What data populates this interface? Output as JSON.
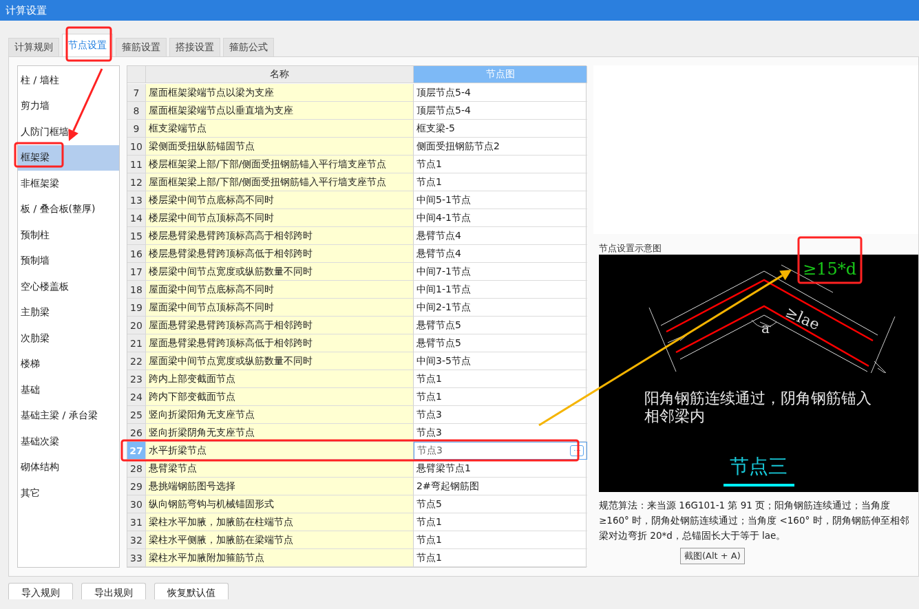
{
  "window": {
    "title": "计算设置"
  },
  "tabs": [
    {
      "label": "计算规则",
      "selected": false
    },
    {
      "label": "节点设置",
      "selected": true
    },
    {
      "label": "箍筋设置",
      "selected": false
    },
    {
      "label": "搭接设置",
      "selected": false
    },
    {
      "label": "箍筋公式",
      "selected": false
    }
  ],
  "sidebar": {
    "items": [
      {
        "label": "柱 / 墙柱",
        "selected": false
      },
      {
        "label": "剪力墙",
        "selected": false
      },
      {
        "label": "人防门框墙",
        "selected": false
      },
      {
        "label": "框架梁",
        "selected": true
      },
      {
        "label": "非框架梁",
        "selected": false
      },
      {
        "label": "板 / 叠合板(整厚)",
        "selected": false
      },
      {
        "label": "预制柱",
        "selected": false
      },
      {
        "label": "预制墙",
        "selected": false
      },
      {
        "label": "空心楼盖板",
        "selected": false
      },
      {
        "label": "主肋梁",
        "selected": false
      },
      {
        "label": "次肋梁",
        "selected": false
      },
      {
        "label": "楼梯",
        "selected": false
      },
      {
        "label": "基础",
        "selected": false
      },
      {
        "label": "基础主梁 / 承台梁",
        "selected": false
      },
      {
        "label": "基础次梁",
        "selected": false
      },
      {
        "label": "砌体结构",
        "selected": false
      },
      {
        "label": "其它",
        "selected": false
      }
    ]
  },
  "table": {
    "columns": [
      "名称",
      "节点图"
    ],
    "cell_button": "⋯",
    "rows": [
      {
        "number": "7",
        "name": "屋面框架梁端节点以梁为支座",
        "value": "顶层节点5-4",
        "selected": false
      },
      {
        "number": "8",
        "name": "屋面框架梁端节点以垂直墙为支座",
        "value": "顶层节点5-4",
        "selected": false
      },
      {
        "number": "9",
        "name": "框支梁端节点",
        "value": "框支梁-5",
        "selected": false
      },
      {
        "number": "10",
        "name": "梁侧面受扭纵筋锚固节点",
        "value": "侧面受扭钢筋节点2",
        "selected": false
      },
      {
        "number": "11",
        "name": "楼层框架梁上部/下部/侧面受扭钢筋锚入平行墙支座节点",
        "value": "节点1",
        "selected": false
      },
      {
        "number": "12",
        "name": "屋面框架梁上部/下部/侧面受扭钢筋锚入平行墙支座节点",
        "value": "节点1",
        "selected": false
      },
      {
        "number": "13",
        "name": "楼层梁中间节点底标高不同时",
        "value": "中间5-1节点",
        "selected": false
      },
      {
        "number": "14",
        "name": "楼层梁中间节点顶标高不同时",
        "value": "中间4-1节点",
        "selected": false
      },
      {
        "number": "15",
        "name": "楼层悬臂梁悬臂跨顶标高高于相邻跨时",
        "value": "悬臂节点4",
        "selected": false
      },
      {
        "number": "16",
        "name": "楼层悬臂梁悬臂跨顶标高低于相邻跨时",
        "value": "悬臂节点4",
        "selected": false
      },
      {
        "number": "17",
        "name": "楼层梁中间节点宽度或纵筋数量不同时",
        "value": "中间7-1节点",
        "selected": false
      },
      {
        "number": "18",
        "name": "屋面梁中间节点底标高不同时",
        "value": "中间1-1节点",
        "selected": false
      },
      {
        "number": "19",
        "name": "屋面梁中间节点顶标高不同时",
        "value": "中间2-1节点",
        "selected": false
      },
      {
        "number": "20",
        "name": "屋面悬臂梁悬臂跨顶标高高于相邻跨时",
        "value": "悬臂节点5",
        "selected": false
      },
      {
        "number": "21",
        "name": "屋面悬臂梁悬臂跨顶标高低于相邻跨时",
        "value": "悬臂节点5",
        "selected": false
      },
      {
        "number": "22",
        "name": "屋面梁中间节点宽度或纵筋数量不同时",
        "value": "中间3-5节点",
        "selected": false
      },
      {
        "number": "23",
        "name": "跨内上部变截面节点",
        "value": "节点1",
        "selected": false
      },
      {
        "number": "24",
        "name": "跨内下部变截面节点",
        "value": "节点1",
        "selected": false
      },
      {
        "number": "25",
        "name": "竖向折梁阳角无支座节点",
        "value": "节点3",
        "selected": false
      },
      {
        "number": "26",
        "name": "竖向折梁阴角无支座节点",
        "value": "节点3",
        "selected": false
      },
      {
        "number": "27",
        "name": "水平折梁节点",
        "value": "节点3",
        "selected": true
      },
      {
        "number": "28",
        "name": "悬臂梁节点",
        "value": "悬臂梁节点1",
        "selected": false
      },
      {
        "number": "29",
        "name": "悬挑端钢筋图号选择",
        "value": "2#弯起钢筋图",
        "selected": false
      },
      {
        "number": "30",
        "name": "纵向钢筋弯钩与机械锚固形式",
        "value": "节点5",
        "selected": false
      },
      {
        "number": "31",
        "name": "梁柱水平加腋，加腋筋在柱端节点",
        "value": "节点1",
        "selected": false
      },
      {
        "number": "32",
        "name": "梁柱水平侧腋，加腋筋在梁端节点",
        "value": "节点1",
        "selected": false
      },
      {
        "number": "33",
        "name": "梁柱水平加腋附加箍筋节点",
        "value": "节点1",
        "selected": false
      }
    ]
  },
  "diagram_panel": {
    "title": "节点设置示意图",
    "diagram": {
      "top_dimension": "≥15*d",
      "side_dimension": "≥lae",
      "angle": "a",
      "caption": "阳角钢筋连续通过，阴角钢筋锚入相邻梁内",
      "node_label": "节点三"
    },
    "description": "规范算法：来当源 16G101-1 第 91 页；阳角钢筋连续通过；当角度 ≥160° 时，阴角处钢筋连续通过；当角度 <160° 时，阴角钢筋伸至相邻梁对边弯折 20*d，总锚固长大于等于 lae。"
  },
  "tooltip": "截图(Alt + A)",
  "buttons": [
    "导入规则",
    "导出规则",
    "恢复默认值"
  ]
}
